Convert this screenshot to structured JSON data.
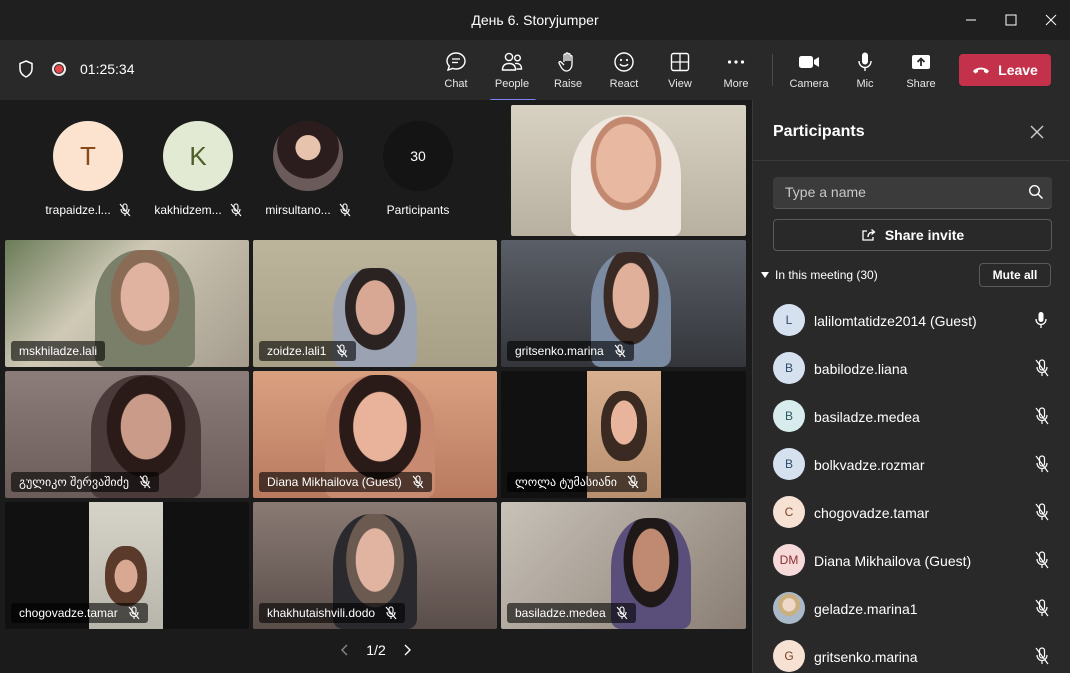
{
  "window": {
    "title": "День 6. Storyjumper"
  },
  "toolbar": {
    "timer": "01:25:34",
    "buttons": [
      {
        "label": "Chat"
      },
      {
        "label": "People"
      },
      {
        "label": "Raise"
      },
      {
        "label": "React"
      },
      {
        "label": "View"
      },
      {
        "label": "More"
      },
      {
        "label": "Camera"
      },
      {
        "label": "Mic"
      },
      {
        "label": "Share"
      }
    ],
    "leave": "Leave"
  },
  "stage": {
    "avatars": [
      {
        "initial": "T",
        "name": "trapaidze.l...",
        "bg": "#fbe3cf",
        "fg": "#8a4b1c"
      },
      {
        "initial": "K",
        "name": "kakhidzem...",
        "bg": "#e3ead3",
        "fg": "#4f5f2a"
      },
      {
        "initial": "",
        "name": "mirsultano...",
        "bg": "#6b5a5a",
        "fg": "#fff"
      },
      {
        "initial": "30",
        "name": "Participants",
        "bg": "#141414",
        "fg": "#fff"
      }
    ],
    "tiles": [
      {
        "name": "mskhiladze.lali"
      },
      {
        "name": "zoidze.lali1"
      },
      {
        "name": "gritsenko.marina"
      },
      {
        "name": "გულიკო შერვაშიძე"
      },
      {
        "name": "Diana Mikhailova (Guest)"
      },
      {
        "name": "ლოლა ტუმასიანი"
      },
      {
        "name": "chogovadze.tamar"
      },
      {
        "name": "khakhutaishvili.dodo"
      },
      {
        "name": "basiladze.medea"
      }
    ],
    "pager": "1/2"
  },
  "panel": {
    "title": "Participants",
    "search_placeholder": "Type a name",
    "share_invite": "Share invite",
    "in_meeting": "In this meeting (30)",
    "mute_all": "Mute all",
    "participants": [
      {
        "initials": "L",
        "name": "lalilomtatidze2014 (Guest)",
        "bg": "#d6e1f0",
        "fg": "#2f4a6b",
        "mic": "on"
      },
      {
        "initials": "B",
        "name": "babilodze.liana",
        "bg": "#d6e1f0",
        "fg": "#2f4a6b",
        "mic": "off"
      },
      {
        "initials": "B",
        "name": "basiladze.medea",
        "bg": "#d8ecee",
        "fg": "#2a5a60",
        "mic": "off"
      },
      {
        "initials": "B",
        "name": "bolkvadze.rozmar",
        "bg": "#d6e1f0",
        "fg": "#2f4a6b",
        "mic": "off"
      },
      {
        "initials": "C",
        "name": "chogovadze.tamar",
        "bg": "#f6e1d3",
        "fg": "#7a4528",
        "mic": "off"
      },
      {
        "initials": "DM",
        "name": "Diana Mikhailova (Guest)",
        "bg": "#f6dada",
        "fg": "#8a2e2e",
        "mic": "off"
      },
      {
        "initials": "",
        "name": "geladze.marina1",
        "bg": "#a9b9c9",
        "fg": "#fff",
        "mic": "off"
      },
      {
        "initials": "G",
        "name": "gritsenko.marina",
        "bg": "#f6e1d3",
        "fg": "#7a4528",
        "mic": "off"
      }
    ]
  }
}
